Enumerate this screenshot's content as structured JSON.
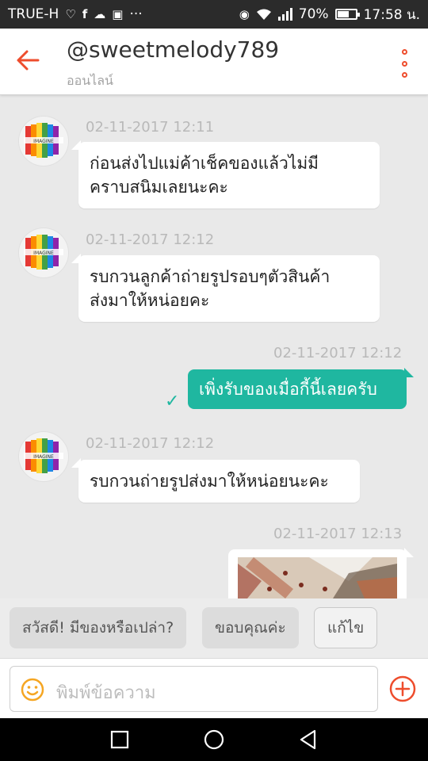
{
  "status_bar": {
    "carrier": "TRUE-H",
    "battery": "70%",
    "battery_level": 0.7,
    "time": "17:58 น.",
    "more": "···"
  },
  "header": {
    "title": "@sweetmelody789",
    "status": "ออนไลน์"
  },
  "messages": [
    {
      "direction": "in",
      "timestamp": "02-11-2017 12:11",
      "lines": [
        "ก่อนส่งไปแม่ค้าเช็คของแล้วไม่มี",
        "คราบสนิมเลยนะคะ"
      ]
    },
    {
      "direction": "in",
      "timestamp": "02-11-2017 12:12",
      "lines": [
        "รบกวนลูกค้าถ่ายรูปรอบๆตัวสินค้า",
        "ส่งมาให้หน่อยคะ"
      ]
    },
    {
      "direction": "out",
      "timestamp": "02-11-2017 12:12",
      "text": "เพิ่งรับของเมื่อกี้นี้เลยครับ",
      "read": true
    },
    {
      "direction": "in",
      "timestamp": "02-11-2017 12:12",
      "text": "รบกวนถ่ายรูปส่งมาให้หน่อยนะคะ"
    },
    {
      "direction": "out",
      "timestamp": "02-11-2017 12:13",
      "type": "image"
    }
  ],
  "quick_replies": [
    "สวัสดี! มีของหรือเปล่า?",
    "ขอบคุณค่ะ",
    "แก้ไข"
  ],
  "input": {
    "placeholder": "พิมพ์ข้อความ"
  },
  "colors": {
    "accent": "#ee4d2d",
    "outgoing_bubble": "#1fb7a0",
    "emoji": "#f5a623"
  },
  "icons": {
    "back": "arrow-left-icon",
    "more": "more-vertical-icon",
    "read": "check-icon",
    "emoji": "smiley-icon",
    "add": "plus-circle-icon",
    "nav": [
      "square-recents-icon",
      "circle-home-icon",
      "triangle-back-icon"
    ]
  }
}
